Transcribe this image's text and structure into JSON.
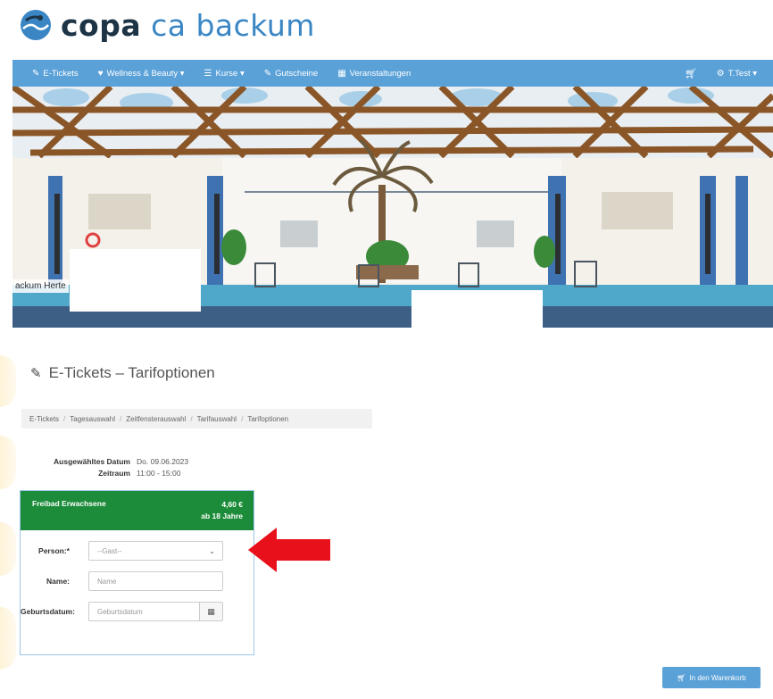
{
  "brand": {
    "part1": "copa",
    "part2": "ca backum"
  },
  "nav": {
    "items": [
      {
        "icon": "ticket-icon",
        "label": "E-Tickets"
      },
      {
        "icon": "heart-icon",
        "label": "Wellness & Beauty ▾"
      },
      {
        "icon": "list-icon",
        "label": "Kurse ▾"
      },
      {
        "icon": "ticket-icon",
        "label": "Gutscheine"
      },
      {
        "icon": "calendar-icon",
        "label": "Veranstaltungen"
      }
    ],
    "cart_icon": "cart-icon",
    "user_label": "T.Test ▾"
  },
  "hero": {
    "caption": "ackum Herte"
  },
  "page": {
    "title": "E-Tickets – Tarifoptionen",
    "breadcrumb": [
      "E-Tickets",
      "Tagesauswahl",
      "Zeitfensterauswahl",
      "Tarifauswahl",
      "Tarifoptionen"
    ]
  },
  "selection": {
    "date_label": "Ausgewähltes Datum",
    "date_value": "Do. 09.06.2023",
    "time_label": "Zeitraum",
    "time_value": "11:00 - 15:00"
  },
  "tariff": {
    "name": "Freibad Erwachsene",
    "price": "4,60 €",
    "age": "ab 18 Jahre",
    "fields": {
      "person_label": "Person:*",
      "person_value": "--Gast--",
      "name_label": "Name:",
      "name_placeholder": "Name",
      "birth_label": "Geburtsdatum:",
      "birth_placeholder": "Geburtsdatum"
    }
  },
  "cart_button": "In den Warenkorb",
  "colors": {
    "nav": "#5aa1d8",
    "card_header": "#1c8c3a",
    "arrow": "#e8101a"
  }
}
